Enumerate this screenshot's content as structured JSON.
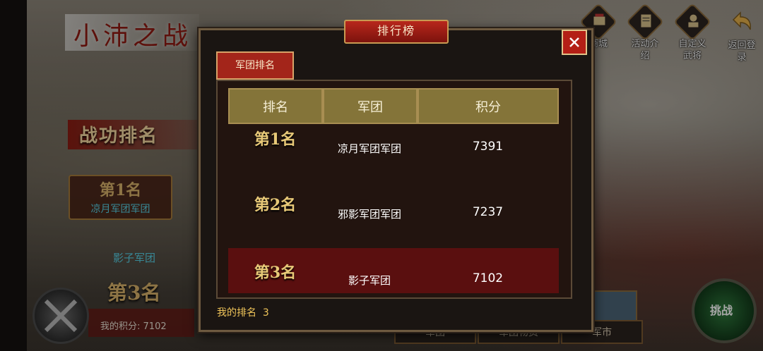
{
  "background": {
    "game_title": "小沛之战",
    "merit_ranking_title": "战功排名",
    "rank_first": "第1名",
    "rank_first_team": "凉月军团军团",
    "shadow_team": "影子军团",
    "rank_third": "第3名",
    "my_score_label": "我的积分:",
    "my_score_value": "7102",
    "challenge_label": "挑战",
    "bottom_tabs": [
      "军团",
      "军团物资",
      "军市"
    ]
  },
  "top_right": [
    {
      "label": "商城",
      "icon": "shop-icon"
    },
    {
      "label": "活动介绍",
      "icon": "event-icon"
    },
    {
      "label": "自定义武将",
      "icon": "general-icon"
    },
    {
      "label": "返回登录",
      "icon": "return-icon"
    }
  ],
  "dialog": {
    "title": "排行榜",
    "tab_label": "军团排名",
    "headers": {
      "rank": "排名",
      "team": "军团",
      "score": "积分"
    },
    "rows": [
      {
        "rank": "第1名",
        "team": "凉月军团军团",
        "score": "7391"
      },
      {
        "rank": "第2名",
        "team": "邪影军团军团",
        "score": "7237"
      },
      {
        "rank": "第3名",
        "team": "影子军团",
        "score": "7102"
      }
    ],
    "my_rank_label": "我的排名",
    "my_rank_value": "3"
  },
  "colors": {
    "accent_red": "#b41f16",
    "gold": "#e8c978",
    "header_olive": "#847439"
  }
}
